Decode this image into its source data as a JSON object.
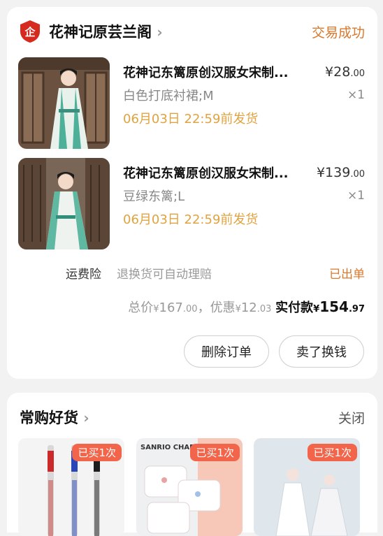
{
  "shop": {
    "name": "花神记原芸兰阁",
    "logo_icon": "enterprise-shield-icon",
    "chevron": "›",
    "status": "交易成功"
  },
  "products": [
    {
      "title": "花神记东篱原创汉服女宋制...",
      "price_symbol": "¥",
      "price_int": "28",
      "price_dec": ".00",
      "spec": "白色打底衬裙;M",
      "qty": "×1",
      "ship_time": "06月03日 22:59前发货"
    },
    {
      "title": "花神记东篱原创汉服女宋制...",
      "price_symbol": "¥",
      "price_int": "139",
      "price_dec": ".00",
      "spec": "豆绿东篱;L",
      "qty": "×1",
      "ship_time": "06月03日 22:59前发货"
    }
  ],
  "insurance": {
    "label": "运费险",
    "desc": "退换货可自动理赔",
    "status": "已出单"
  },
  "totals": {
    "total_label": "总价",
    "total_sym": "¥",
    "total_int": "167",
    "total_dec": ".00",
    "sep": "，",
    "discount_label": "优惠",
    "discount_sym": "¥",
    "discount_int": "12",
    "discount_dec": ".03",
    "paid_label": "实付款",
    "paid_sym": "¥",
    "paid_int": "154",
    "paid_dec": ".97"
  },
  "actions": {
    "delete_order": "删除订单",
    "resell": "卖了换钱"
  },
  "recommend": {
    "title": "常购好货",
    "chevron": "›",
    "close": "关闭",
    "items": [
      {
        "badge": "已买1次",
        "printed_text": ""
      },
      {
        "badge": "已买1次",
        "printed_text": "SANRIO CHARACT"
      },
      {
        "badge": "已买1次",
        "printed_text": ""
      }
    ]
  },
  "colors": {
    "accent_orange": "#d9782d",
    "ship_yellow": "#e0a33f",
    "badge_red": "#f2654a"
  }
}
